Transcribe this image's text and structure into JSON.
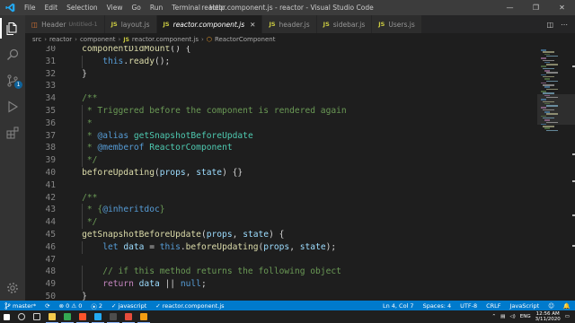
{
  "titlebar": {
    "title": "reactor.component.js - reactor - Visual Studio Code",
    "menu": [
      "File",
      "Edit",
      "Selection",
      "View",
      "Go",
      "Run",
      "Terminal",
      "Help"
    ],
    "controls": {
      "minimize": "—",
      "restore": "❐",
      "close": "✕"
    }
  },
  "tabs": [
    {
      "label": "Header",
      "sub": "Untitled-1",
      "icon": "html5-icon",
      "active": false
    },
    {
      "label": "layout.js",
      "icon": "js-icon",
      "active": false
    },
    {
      "label": "reactor.component.js",
      "icon": "js-icon",
      "active": true
    },
    {
      "label": "header.js",
      "icon": "js-icon",
      "active": false
    },
    {
      "label": "sidebar.js",
      "icon": "js-icon",
      "active": false
    },
    {
      "label": "Users.js",
      "icon": "js-icon",
      "active": false
    }
  ],
  "tab_icons": {
    "js": "JS",
    "html5": "◫"
  },
  "tab_actions": {
    "split": "◫",
    "more": "⋯"
  },
  "breadcrumbs": [
    "src",
    "reactor",
    "component",
    "reactor.component.js",
    "ReactorComponent"
  ],
  "editor": {
    "lines": [
      {
        "n": "30",
        "tokens": [
          [
            "fn",
            "    componentDidMount"
          ],
          [
            "ident",
            "() {"
          ]
        ]
      },
      {
        "n": "31",
        "tokens": [
          [
            "kw",
            "        this"
          ],
          [
            "ident",
            "."
          ],
          [
            "fn",
            "ready"
          ],
          [
            "ident",
            "();"
          ]
        ]
      },
      {
        "n": "32",
        "tokens": [
          [
            "ident",
            "    }"
          ]
        ]
      },
      {
        "n": "33",
        "tokens": []
      },
      {
        "n": "34",
        "tokens": [
          [
            "cmt",
            "    /**"
          ]
        ]
      },
      {
        "n": "35",
        "tokens": [
          [
            "cmt",
            "     * Triggered before the component is rendered again"
          ]
        ]
      },
      {
        "n": "36",
        "tokens": [
          [
            "cmt",
            "     *"
          ]
        ]
      },
      {
        "n": "37",
        "tokens": [
          [
            "cmt",
            "     * "
          ],
          [
            "tag",
            "@alias"
          ],
          [
            "cmt",
            " "
          ],
          [
            "ref",
            "getSnapshotBeforeUpdate"
          ]
        ]
      },
      {
        "n": "38",
        "tokens": [
          [
            "cmt",
            "     * "
          ],
          [
            "tag",
            "@memberof"
          ],
          [
            "cmt",
            " "
          ],
          [
            "ref",
            "ReactorComponent"
          ]
        ]
      },
      {
        "n": "39",
        "tokens": [
          [
            "cmt",
            "     */"
          ]
        ]
      },
      {
        "n": "40",
        "tokens": [
          [
            "fn",
            "    beforeUpdating"
          ],
          [
            "ident",
            "("
          ],
          [
            "param",
            "props"
          ],
          [
            "ident",
            ", "
          ],
          [
            "param",
            "state"
          ],
          [
            "ident",
            ") {}"
          ]
        ]
      },
      {
        "n": "41",
        "tokens": []
      },
      {
        "n": "42",
        "tokens": [
          [
            "cmt",
            "    /**"
          ]
        ]
      },
      {
        "n": "43",
        "tokens": [
          [
            "cmt",
            "     * {"
          ],
          [
            "tag",
            "@inheritdoc"
          ],
          [
            "cmt",
            "}"
          ]
        ]
      },
      {
        "n": "44",
        "tokens": [
          [
            "cmt",
            "     */"
          ]
        ]
      },
      {
        "n": "45",
        "tokens": [
          [
            "fn",
            "    getSnapshotBeforeUpdate"
          ],
          [
            "ident",
            "("
          ],
          [
            "param",
            "props"
          ],
          [
            "ident",
            ", "
          ],
          [
            "param",
            "state"
          ],
          [
            "ident",
            ") {"
          ]
        ]
      },
      {
        "n": "46",
        "tokens": [
          [
            "kw",
            "        let "
          ],
          [
            "param",
            "data"
          ],
          [
            "ident",
            " = "
          ],
          [
            "kw",
            "this"
          ],
          [
            "ident",
            "."
          ],
          [
            "fn",
            "beforeUpdating"
          ],
          [
            "ident",
            "("
          ],
          [
            "param",
            "props"
          ],
          [
            "ident",
            ", "
          ],
          [
            "param",
            "state"
          ],
          [
            "ident",
            ");"
          ]
        ]
      },
      {
        "n": "47",
        "tokens": []
      },
      {
        "n": "48",
        "tokens": [
          [
            "cmt",
            "        // if this method returns the following object"
          ]
        ]
      },
      {
        "n": "49",
        "tokens": [
          [
            "kw2",
            "        return "
          ],
          [
            "param",
            "data"
          ],
          [
            "ident",
            " || "
          ],
          [
            "kw",
            "null"
          ],
          [
            "ident",
            ";"
          ]
        ]
      },
      {
        "n": "50",
        "tokens": [
          [
            "ident",
            "    }"
          ]
        ]
      }
    ]
  },
  "statusbar": {
    "branch": "master*",
    "sync": "⟳",
    "problems": "⊗ 0 ⚠ 0",
    "ports": "2",
    "language_check": "✓ javascript",
    "file_check": "✓ reactor.component.js",
    "position": "Ln 4, Col 7",
    "spaces": "Spaces: 4",
    "encoding": "UTF-8",
    "eol": "CRLF",
    "language": "JavaScript",
    "feedback": "☺",
    "bell": "🔔"
  },
  "taskbar": {
    "apps": [
      {
        "name": "start",
        "color": "#ffffff"
      },
      {
        "name": "search",
        "color": "#d0d0d0"
      },
      {
        "name": "task-view",
        "color": "#d0d0d0"
      },
      {
        "name": "file-explorer",
        "color": "#f2c94c"
      },
      {
        "name": "chrome",
        "color": "#34a853"
      },
      {
        "name": "brave",
        "color": "#fb542b"
      },
      {
        "name": "vscode",
        "color": "#23a9f2"
      },
      {
        "name": "terminal",
        "color": "#4d4d4d"
      },
      {
        "name": "app-red",
        "color": "#e74c3c"
      },
      {
        "name": "app-orange",
        "color": "#f39c12"
      }
    ],
    "lang": "ENG",
    "time": "12:56 AM",
    "date": "3/11/2020"
  },
  "colors": {
    "accent": "#007acc",
    "activity": "#333333",
    "editor_bg": "#1e1e1e"
  }
}
